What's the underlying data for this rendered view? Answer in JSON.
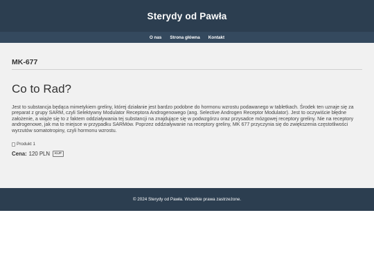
{
  "header": {
    "title": "Sterydy od Pawła"
  },
  "nav": {
    "items": [
      "O nas",
      "Strona główna",
      "Kontakt"
    ]
  },
  "main": {
    "product_code": "MK-677",
    "headline": "Co to Rad?",
    "description": "Jest to substancja będąca mimetykiem greliny, której działanie jest bardzo podobne do hormonu wzrostu podawanego w tabletkach. Środek ten uznaje się za preparat z grupy SARM, czyli Selektywny Modulator Receptora Androgenowego (ang. Selective Androgen Receptor Modulator). Jest to oczywiście błędne założenie, a wiąże się to z faktem oddziaływania tej substancji na znajdujące się w podwzgórzu oraz przysadce mózgowej receptory greliny. Nie na receptory androgenowe, jak ma to miejsce w przypadku SARMów. Poprzez oddziaływanie na receptory greliny, MK 677 przyczynia się do zwiększenia częstotliwości wyrzutów somatotropiny, czyli hormonu wzrostu.",
    "image_alt": "Produkt 1",
    "price_label": "Cena:",
    "price_value": "120 PLN",
    "buy_label": "KUP"
  },
  "footer": {
    "text": "© 2024 Sterydy od Pawła. Wszelkie prawa zastrzeżone."
  },
  "colors": {
    "header_bg": "#2c3e50",
    "nav_bg": "#34495e",
    "page_bg": "#f1f1f1"
  }
}
